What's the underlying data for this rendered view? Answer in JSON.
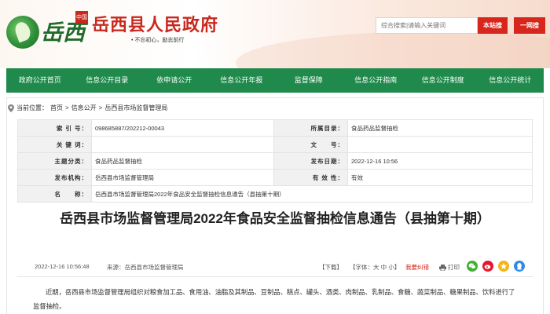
{
  "header": {
    "logo_text": "岳西",
    "logo_seal": "中国",
    "gov_name": "岳西县人民政府",
    "slogan": "• 不忘初心，励志前行",
    "search": {
      "placeholder": "综合搜索|请输入关键词"
    },
    "btn_site": "本站搜",
    "btn_all": "一网搜"
  },
  "nav": [
    "政府公开首页",
    "信息公开目录",
    "依申请公开",
    "信息公开年报",
    "监督保障",
    "信息公开指南",
    "信息公开制度",
    "信息公开统计"
  ],
  "breadcrumb": {
    "prefix": "当前位置：",
    "items": [
      "首页",
      "信息公开",
      "岳西县市场监督管理局"
    ],
    "separator": ">"
  },
  "meta": {
    "index_label": "索 引 号：",
    "index_value": "098685887/202212-00043",
    "catalog_label": "所属目录：",
    "catalog_value": "食品药品监督抽检",
    "keyword_label": "关 键 词：",
    "keyword_value": "",
    "docno_label": "文　　号：",
    "docno_value": "",
    "category_label": "主题分类：",
    "category_value": "食品药品监督抽检",
    "pubdate_label": "发布日期：",
    "pubdate_value": "2022-12-16 10:56",
    "org_label": "发布机构：",
    "org_value": "岳西县市场监督管理局",
    "validity_label": "有 效 性：",
    "validity_value": "有效",
    "name_label": "名　　称：",
    "name_value": "岳西县市场监督管理局2022年食品安全监督抽检信息通告（县抽第十期）"
  },
  "article": {
    "title": "岳西县市场监督管理局2022年食品安全监督抽检信息通告（县抽第十期）",
    "date": "2022-12-16 10:56:48",
    "source": "来源：岳西县市场监督管理局",
    "download": "【下载】",
    "fontsize_prefix": "【字体：",
    "fontsize_large": "大",
    "fontsize_mid": "中",
    "fontsize_small": "小",
    "fontsize_suffix": "】",
    "error_link": "我要纠错",
    "print": "打印",
    "body": "近期，岳西县市场监督管理局组织对粮食加工品、食用油、油脂及其制品、豆制品、糕点、罐头、酒类、肉制品、乳制品、食糖、蔬菜制品、糖果制品、饮料进行了监督抽检。"
  },
  "share_icons": [
    "wechat-icon",
    "weibo-icon",
    "qzone-icon",
    "qq-icon"
  ],
  "colors": {
    "nav_green": "#1f8a4c",
    "brand_red": "#c8281e",
    "button_red": "#d7261c"
  }
}
